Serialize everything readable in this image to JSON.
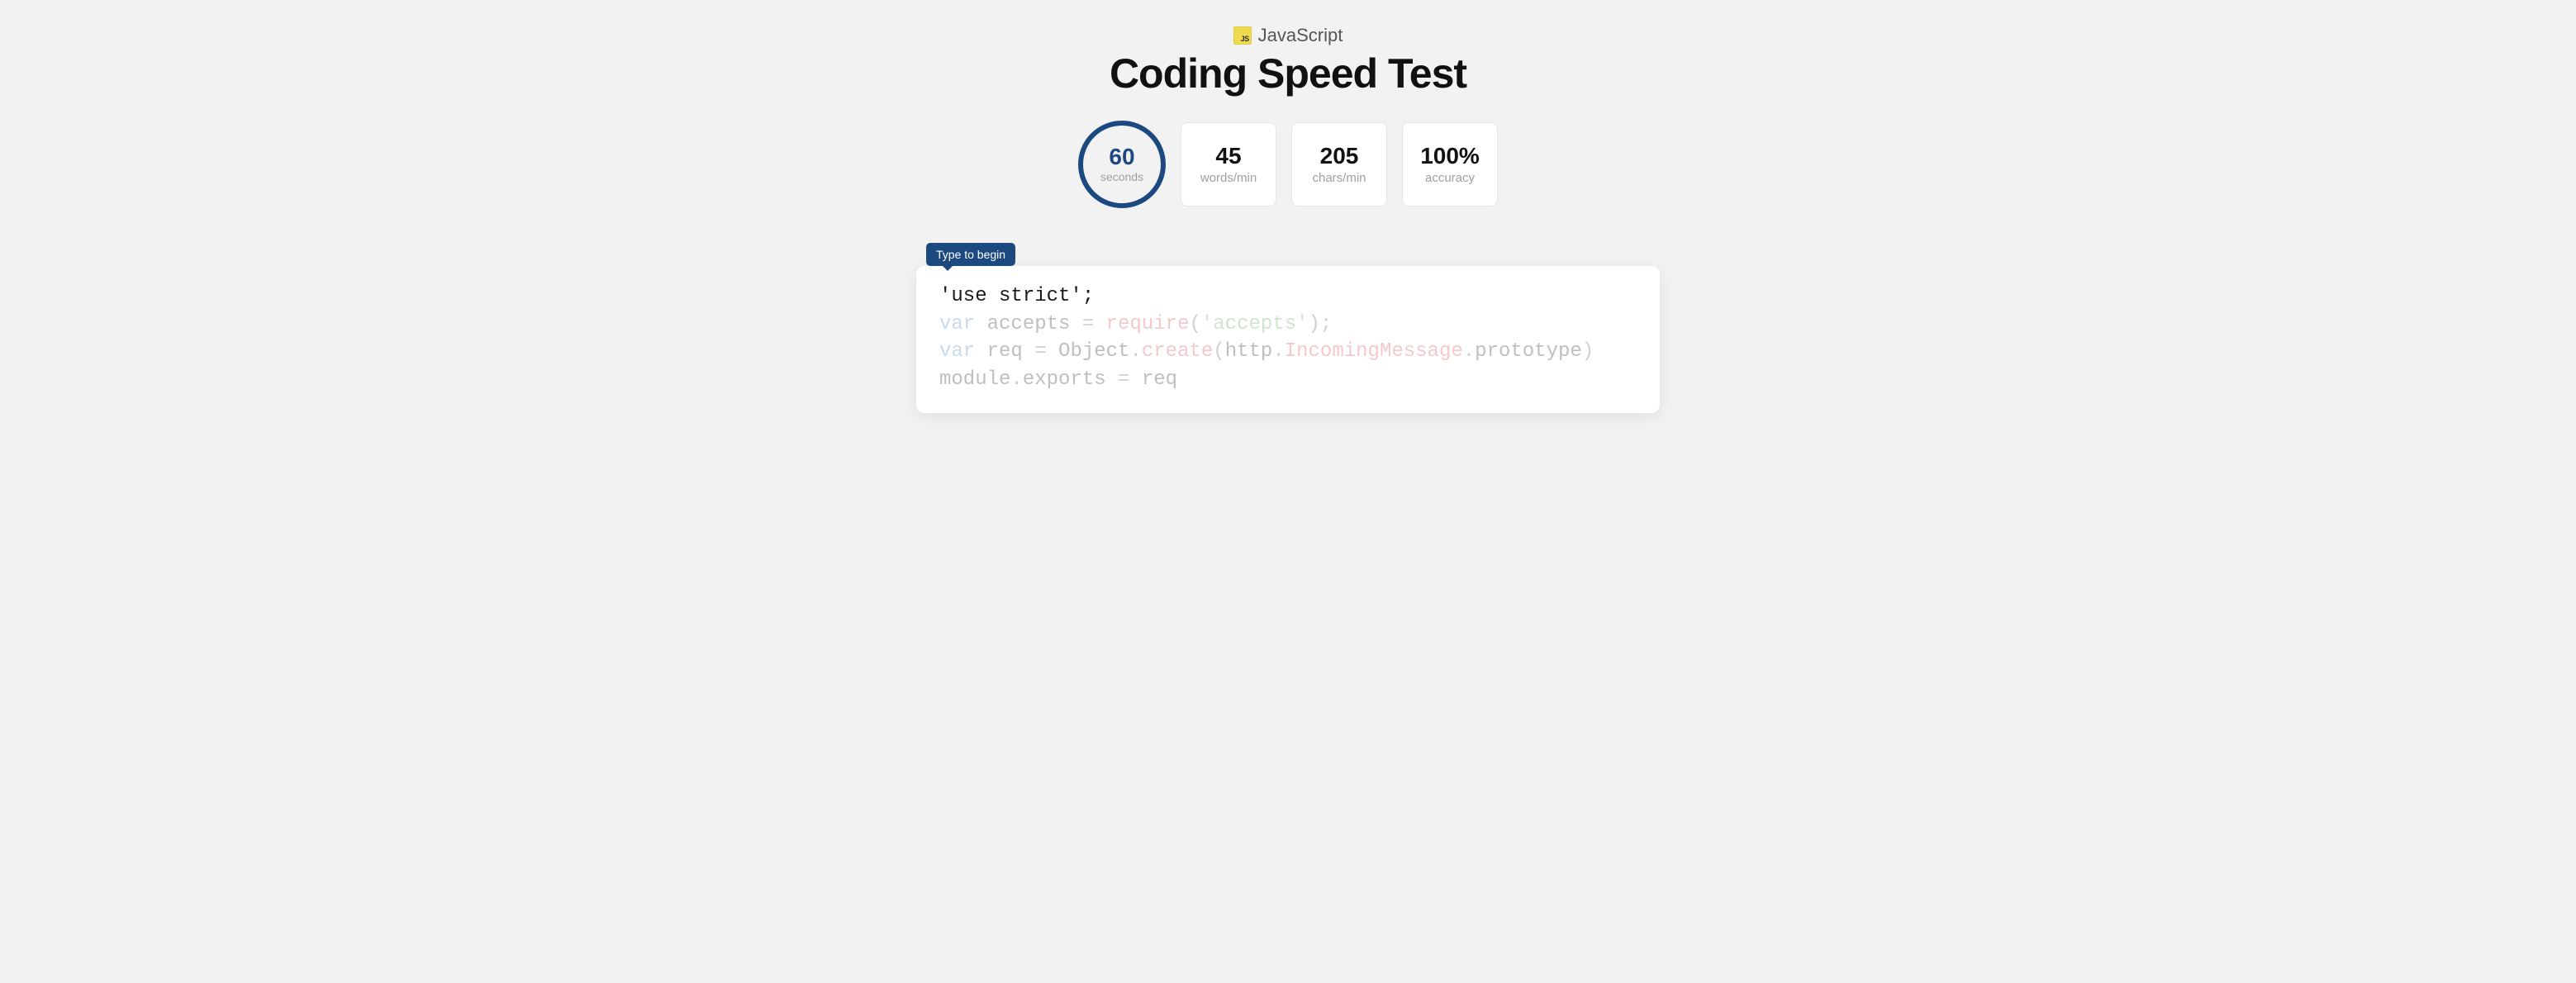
{
  "header": {
    "language": "JavaScript",
    "js_badge_text": "JS",
    "title": "Coding Speed Test"
  },
  "timer": {
    "value": "60",
    "label": "seconds"
  },
  "stats": [
    {
      "value": "45",
      "label": "words/min"
    },
    {
      "value": "205",
      "label": "chars/min"
    },
    {
      "value": "100%",
      "label": "accuracy"
    }
  ],
  "tooltip": "Type to begin",
  "code": {
    "line1_current": "'use strict';",
    "line2": {
      "kw": "var",
      "name": " accepts ",
      "eq": "=",
      "fn": " require",
      "p1": "(",
      "str": "'accepts'",
      "p2": ")",
      "semi": ";"
    },
    "line3": {
      "kw": "var",
      "name": " req ",
      "eq": "=",
      "obj": " Object",
      "dot1": ".",
      "create": "create",
      "p1": "(",
      "http": "http",
      "dot2": ".",
      "inmsg": "IncomingMessage",
      "dot3": ".",
      "proto": "prototype",
      "p2": ")"
    },
    "line4": {
      "module": "module",
      "dot1": ".",
      "exports": "exports ",
      "eq": "=",
      "req": " req"
    }
  }
}
